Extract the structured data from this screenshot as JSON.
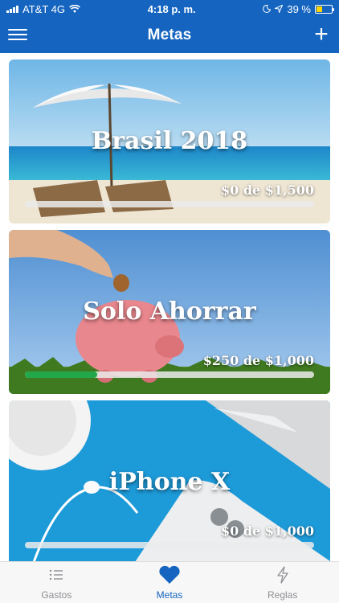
{
  "status_bar": {
    "carrier": "AT&T 4G",
    "time": "4:18 p. m.",
    "battery_percent": "39 %",
    "battery_level": 0.39,
    "signal_bars": 4
  },
  "nav": {
    "title": "Metas",
    "menu_icon": "hamburger-menu-icon",
    "add_icon": "plus-icon",
    "add_label": "+"
  },
  "goals": [
    {
      "title": "Brasil 2018",
      "amount_text": "$0 de $1,500",
      "saved": 0,
      "target": 1500,
      "progress": 0.0,
      "image": "beach-umbrella-photo"
    },
    {
      "title": "Solo Ahorrar",
      "amount_text": "$250 de $1,000",
      "saved": 250,
      "target": 1000,
      "progress": 0.25,
      "image": "piggy-bank-photo"
    },
    {
      "title": "iPhone X",
      "amount_text": "$0 de $1,000",
      "saved": 0,
      "target": 1000,
      "progress": 0.0,
      "image": "phone-desk-photo"
    }
  ],
  "tabs": [
    {
      "label": "Gastos",
      "icon": "list-icon",
      "active": false
    },
    {
      "label": "Metas",
      "icon": "heart-icon",
      "active": true
    },
    {
      "label": "Reglas",
      "icon": "lightning-icon",
      "active": false
    }
  ],
  "colors": {
    "brand_blue": "#1565c0",
    "progress_green": "#22a84a",
    "tab_inactive": "#8e8e93"
  }
}
